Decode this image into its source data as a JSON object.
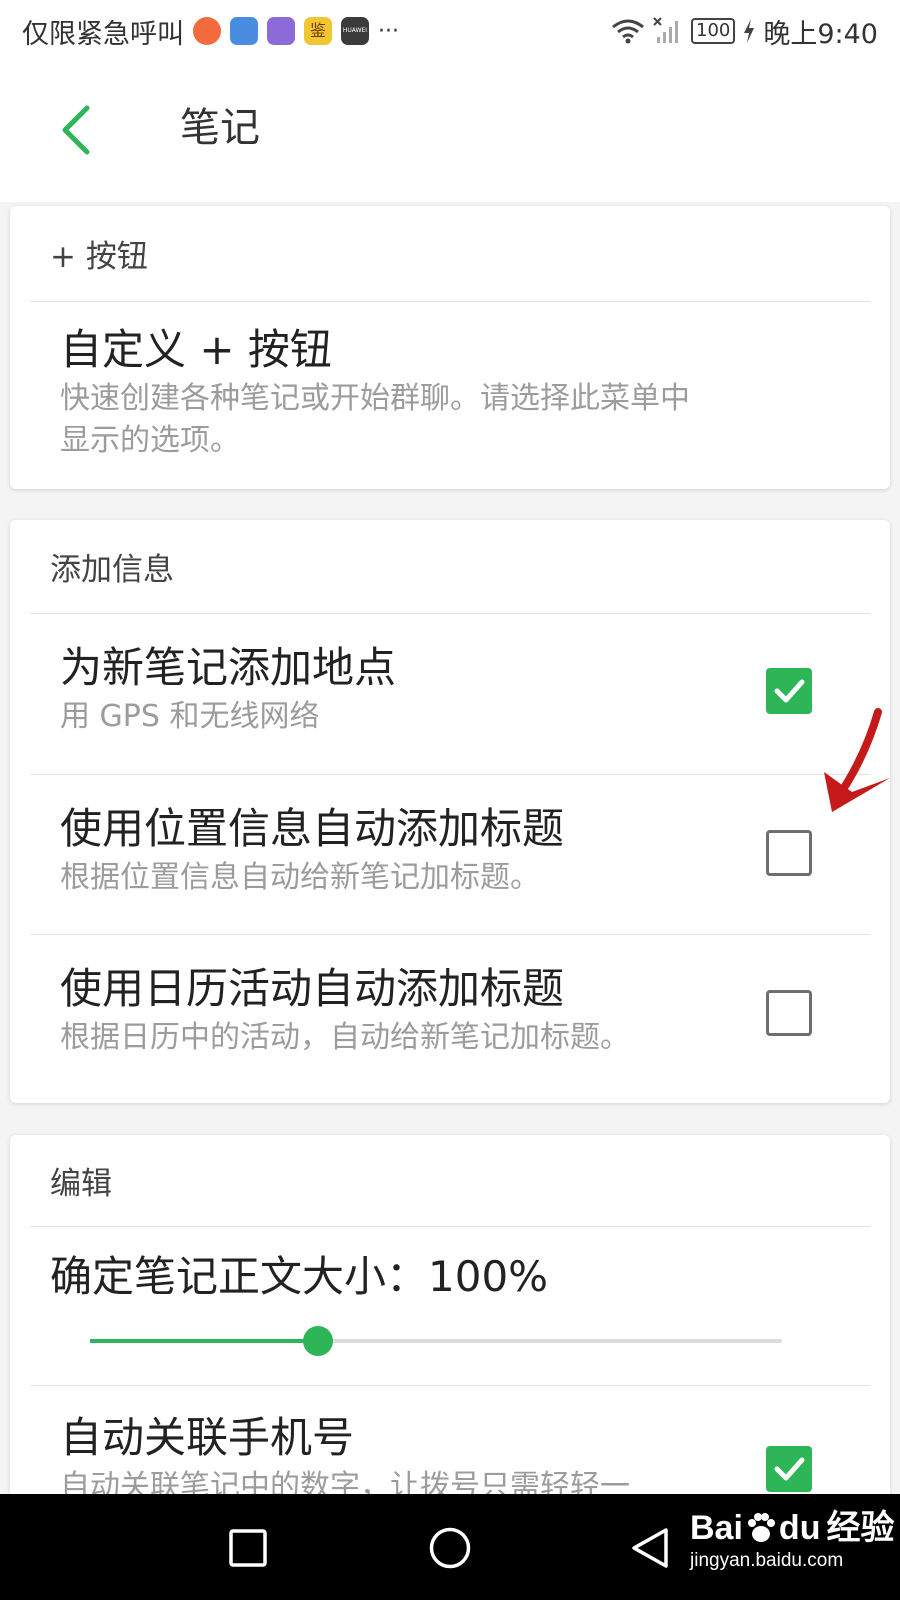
{
  "status_bar": {
    "notice": "仅限紧急呼叫",
    "more": "···",
    "battery": "100",
    "time": "晚上9:40",
    "app_icons": [
      {
        "name": "app-icon-orange",
        "color": "#f36b3c"
      },
      {
        "name": "app-icon-blue",
        "color": "#4a8de0"
      },
      {
        "name": "app-icon-purple",
        "color": "#8c6ad8"
      },
      {
        "name": "app-icon-yellow",
        "color": "#f1c633"
      },
      {
        "name": "app-icon-dark",
        "color": "#3b3b3b"
      }
    ],
    "icon_labels": {
      "yellow": "鉴",
      "dark": "HUAWEI"
    }
  },
  "header": {
    "title": "笔记",
    "back_icon": "chevron-left-icon",
    "accent": "#2db558"
  },
  "sections": {
    "plus": {
      "header": "+ 按钮",
      "item_title": "自定义 + 按钮",
      "item_sub_line1": "快速创建各种笔记或开始群聊。请选择此菜单中",
      "item_sub_line2": "显示的选项。"
    },
    "add_info": {
      "header": "添加信息",
      "items": [
        {
          "title": "为新笔记添加地点",
          "subtitle": "用 GPS 和无线网络",
          "checked": true
        },
        {
          "title": "使用位置信息自动添加标题",
          "subtitle": "根据位置信息自动给新笔记加标题。",
          "checked": false
        },
        {
          "title": "使用日历活动自动添加标题",
          "subtitle": "根据日历中的活动，自动给新笔记加标题。",
          "checked": false
        }
      ]
    },
    "edit": {
      "header": "编辑",
      "font_size_label": "确定笔记正文大小：100%",
      "slider_fraction": 0.33,
      "auto_phone_title": "自动关联手机号",
      "auto_phone_sub": "自动关联笔记中的数字，让拨号只需轻轻一",
      "auto_phone_checked": true
    }
  },
  "annotation": {
    "icon": "red-arrow-icon",
    "color": "#c41a1a"
  },
  "watermark": {
    "brand_a": "Bai",
    "brand_b": "du",
    "suffix": "经验",
    "url": "jingyan.baidu.com"
  }
}
